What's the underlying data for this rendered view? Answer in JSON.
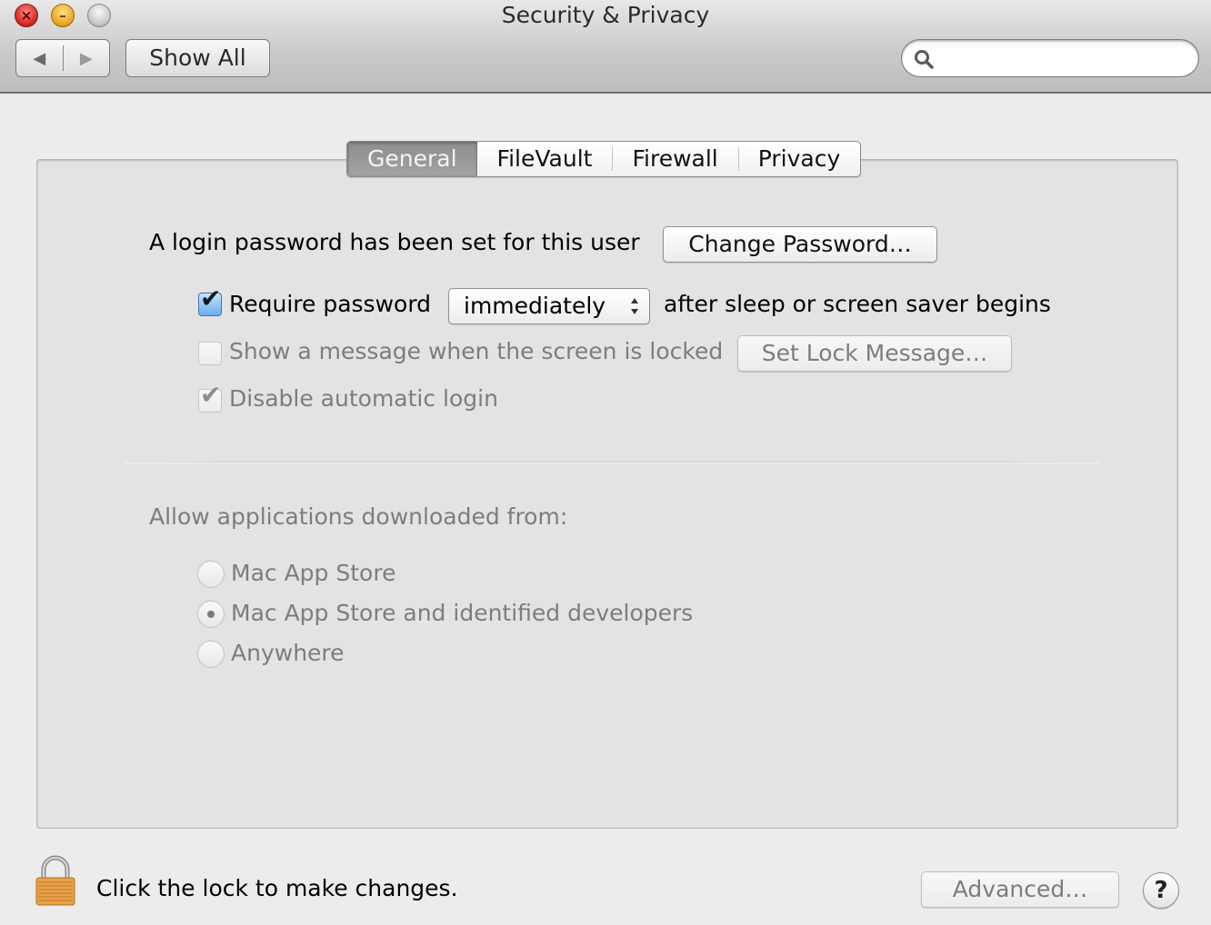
{
  "window": {
    "title": "Security & Privacy",
    "controls": {
      "close": "×",
      "minimize": "–"
    }
  },
  "toolbar": {
    "back_glyph": "◀",
    "forward_glyph": "▶",
    "show_all_label": "Show All",
    "search": {
      "value": "",
      "placeholder": ""
    }
  },
  "tabs": [
    {
      "label": "General",
      "selected": true
    },
    {
      "label": "FileVault",
      "selected": false
    },
    {
      "label": "Firewall",
      "selected": false
    },
    {
      "label": "Privacy",
      "selected": false
    }
  ],
  "general": {
    "login_password_text": "A login password has been set for this user",
    "change_password_label": "Change Password…",
    "require_password": {
      "label": "Require password",
      "checked": true,
      "check_glyph": "✔",
      "popup_value": "immediately",
      "suffix": "after sleep or screen saver begins"
    },
    "show_message": {
      "label": "Show a message when the screen is locked",
      "checked": false,
      "enabled": false,
      "button_label": "Set Lock Message…"
    },
    "disable_auto_login": {
      "label": "Disable automatic login",
      "checked": true,
      "enabled": false,
      "check_glyph": "✔"
    },
    "allow_apps": {
      "heading": "Allow applications downloaded from:",
      "options": [
        {
          "label": "Mac App Store",
          "selected": false
        },
        {
          "label": "Mac App Store and identified developers",
          "selected": true
        },
        {
          "label": "Anywhere",
          "selected": false
        }
      ]
    }
  },
  "footer": {
    "lock_text": "Click the lock to make changes.",
    "advanced_label": "Advanced…",
    "help_label": "?"
  }
}
